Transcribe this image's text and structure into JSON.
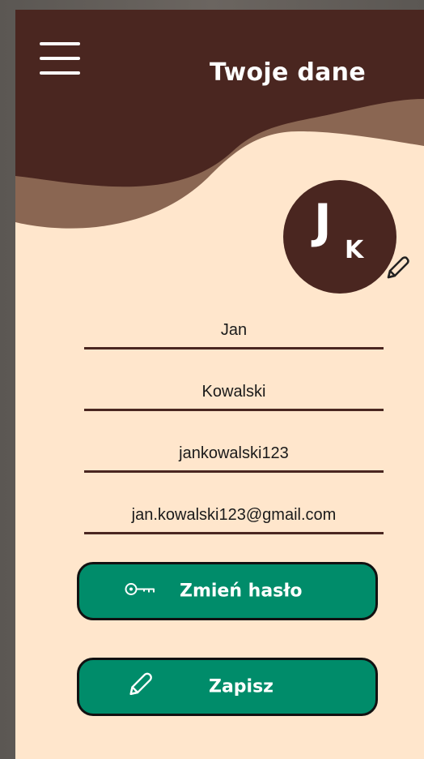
{
  "header": {
    "title": "Twoje dane",
    "menu_icon": "hamburger-menu-icon"
  },
  "avatar": {
    "initial_first": "J",
    "initial_last": "K",
    "edit_icon": "pencil-icon"
  },
  "form": {
    "first_name": "Jan",
    "last_name": "Kowalski",
    "username": "jankowalski123",
    "email": "jan.kowalski123@gmail.com"
  },
  "buttons": {
    "change_password": {
      "label": "Zmień hasło",
      "icon": "key-icon"
    },
    "save": {
      "label": "Zapisz",
      "icon": "pencil-icon"
    }
  },
  "colors": {
    "background": "#ffe6cc",
    "header_dark": "#4a2620",
    "header_wave": "#8a6652",
    "accent": "#008c6a",
    "field_underline": "#4a2620"
  }
}
